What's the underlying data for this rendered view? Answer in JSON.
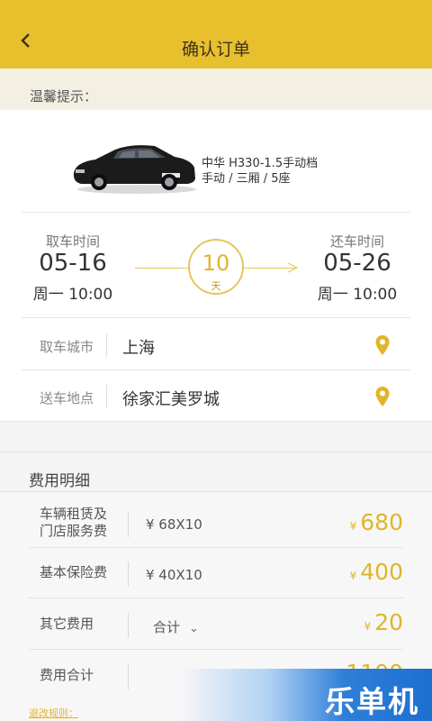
{
  "header": {
    "title": "确认订单",
    "back_icon": "chevron-left-icon"
  },
  "tip": {
    "label": "温馨提示："
  },
  "car": {
    "model": "中华 H330-1.5手动档",
    "spec": "手动 / 三厢 / 5座"
  },
  "pickup": {
    "label": "取车时间",
    "date": "05-16",
    "time": "周一 10:00"
  },
  "return": {
    "label": "还车时间",
    "date": "05-26",
    "time": "周一 10:00"
  },
  "duration": {
    "value": "10",
    "unit": "天"
  },
  "pickup_city": {
    "label": "取车城市",
    "value": "上海",
    "icon": "location-pin-icon"
  },
  "delivery": {
    "label": "送车地点",
    "value": "徐家汇美罗城",
    "icon": "location-pin-icon"
  },
  "fees": {
    "section_title": "费用明细",
    "currency": "¥",
    "rental": {
      "label_line1": "车辆租赁及",
      "label_line2": "门店服务费",
      "formula": "¥ 68X10",
      "amount": "680"
    },
    "insurance": {
      "label": "基本保险费",
      "formula": "¥ 40X10",
      "amount": "400"
    },
    "other": {
      "label": "其它费用",
      "selector": "合计",
      "amount": "20"
    },
    "total": {
      "label": "费用合计",
      "amount": "1100"
    }
  },
  "policy_link": "退改规则：",
  "watermark": "乐单机",
  "colors": {
    "accent": "#e8bf2c",
    "price": "#e0b52a",
    "watermark_blue": "#1d6fd0"
  }
}
